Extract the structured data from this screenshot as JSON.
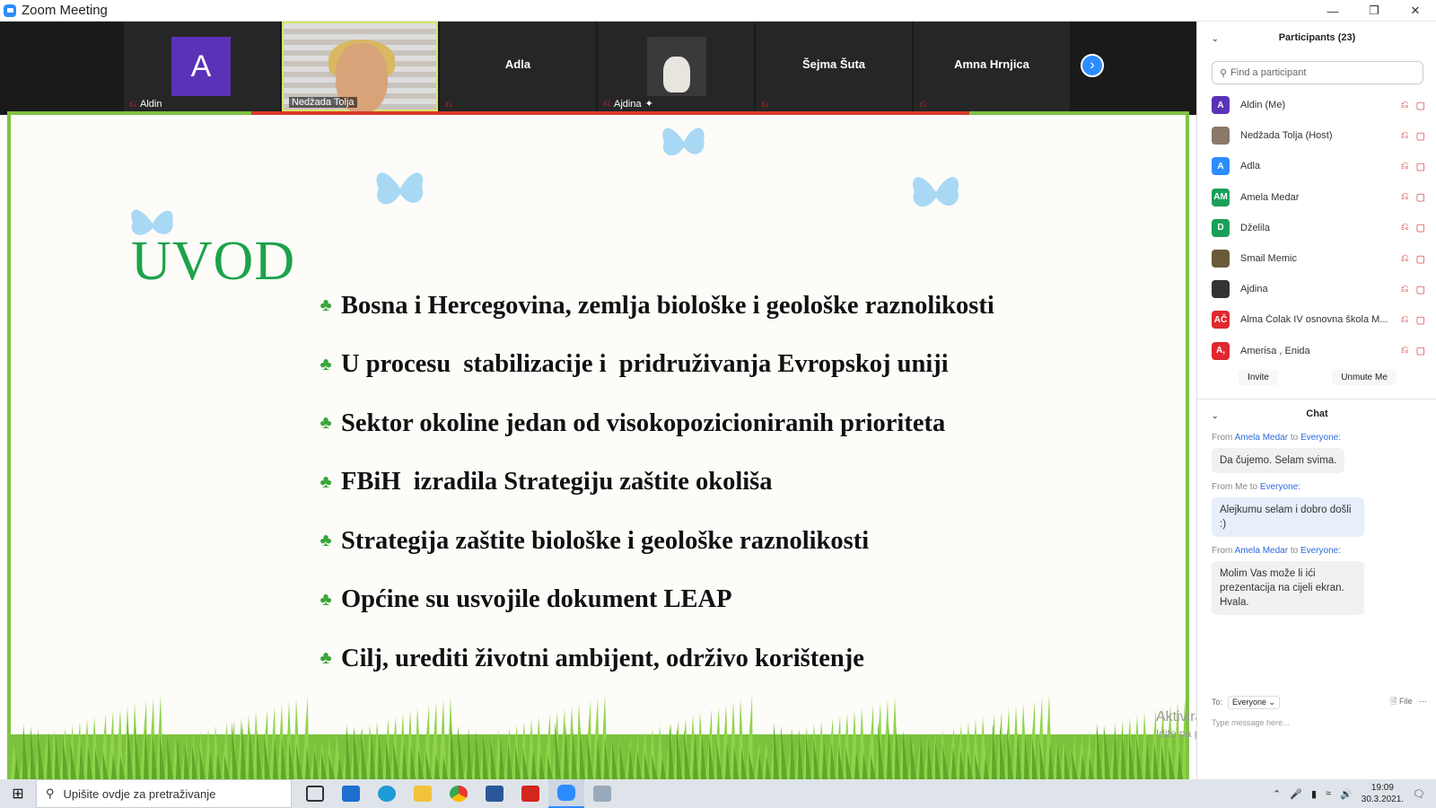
{
  "window": {
    "title": "Zoom Meeting"
  },
  "strip": {
    "tiles": [
      {
        "name": "Aldin",
        "initial": "A"
      },
      {
        "name": "Nedžada Tolja"
      },
      {
        "name": "Adla"
      },
      {
        "name": "Ajdina"
      },
      {
        "name": "Šejma Šuta"
      },
      {
        "name": "Amna Hrnjica"
      }
    ]
  },
  "slide": {
    "title": "UVOD",
    "bullets": [
      "Bosna i Hercegovina, zemlja biološke i geološke raznolikosti",
      "U procesu  stabilizacije i  pridruživanja Evropskoj uniji",
      "Sektor okoline jedan od visokopozicioniranih prioriteta",
      "FBiH  izradila Strategiju zaštite okoliša",
      "Strategija zaštite biološke i geološke raznolikosti",
      "Općine su usvojile dokument LEAP",
      "Cilj, urediti životni ambijent, održivo korištenje"
    ],
    "title_color": "#1ea24b",
    "border_color": "#7ec242"
  },
  "watermark": {
    "line1": "Aktivirajte sustav Windows",
    "line2": "Idite na postavke da biste aktivirali Windows."
  },
  "participants": {
    "header": "Participants (23)",
    "search_placeholder": "Find a participant",
    "list": [
      {
        "initials": "A",
        "name": "Aldin (Me)",
        "color": "#5a32b8"
      },
      {
        "initials": "",
        "name": "Nedžada Tolja (Host)",
        "color": "#8a7868"
      },
      {
        "initials": "A",
        "name": "Adla",
        "color": "#2d8cff"
      },
      {
        "initials": "AM",
        "name": "Amela Medar",
        "color": "#1aa05a"
      },
      {
        "initials": "D",
        "name": "Dželila",
        "color": "#1aa05a"
      },
      {
        "initials": "",
        "name": "Smail Memic",
        "color": "#6b5a3a"
      },
      {
        "initials": "",
        "name": "Ajdina",
        "color": "#333333"
      },
      {
        "initials": "AČ",
        "name": "Alma Čolak IV osnovna škola M...",
        "color": "#e0282e"
      },
      {
        "initials": "A,",
        "name": "Amerisa , Enida",
        "color": "#e0282e"
      }
    ],
    "invite_label": "Invite",
    "unmute_label": "Unmute Me"
  },
  "chat": {
    "header": "Chat",
    "messages": [
      {
        "from_prefix": "From",
        "sender": "Amela Medar",
        "to_word": "to",
        "recipient": "Everyone:",
        "text": "Da čujemo. Selam svima."
      },
      {
        "from_prefix": "From Me",
        "sender": "",
        "to_word": "to",
        "recipient": "Everyone:",
        "text": "Alejkumu selam i dobro došli :)"
      },
      {
        "from_prefix": "From",
        "sender": "Amela Medar",
        "to_word": "to",
        "recipient": "Everyone:",
        "text": "Molim Vas može li ići prezentacija na cijeli ekran. Hvala."
      }
    ],
    "to_label": "To:",
    "to_value": "Everyone",
    "file_label": "File",
    "input_placeholder": "Type message here..."
  },
  "taskbar": {
    "search_placeholder": "Upišite ovdje za pretraživanje",
    "time": "19:09",
    "date": "30.3.2021."
  }
}
